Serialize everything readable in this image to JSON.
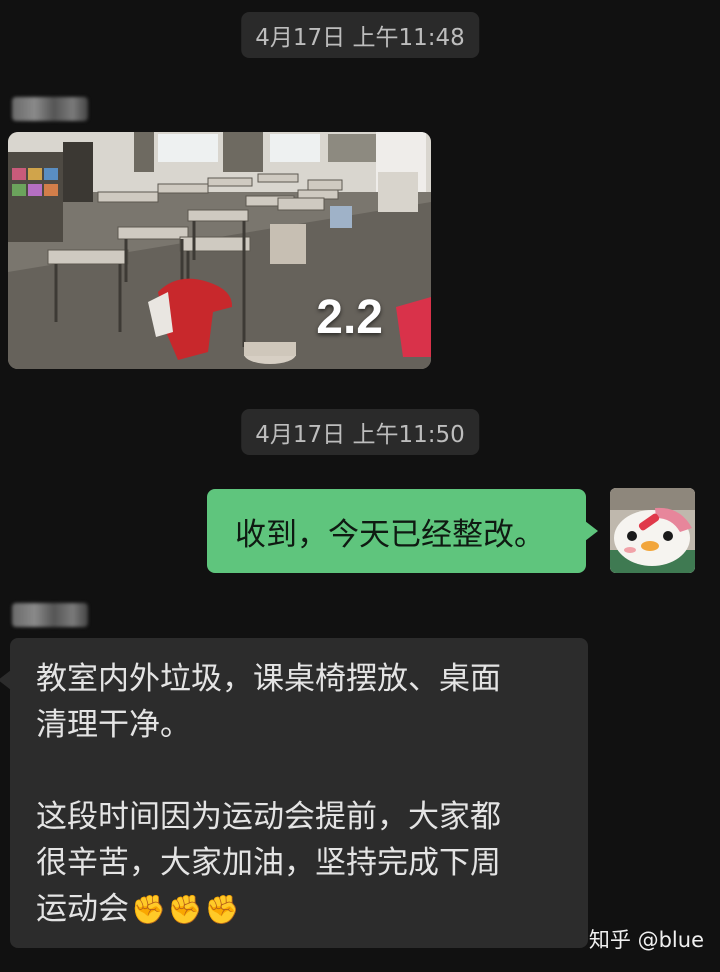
{
  "chat": {
    "timestamp_1": "4月17日 上午11:48",
    "timestamp_2": "4月17日 上午11:50",
    "sender_1_name": "",
    "sender_2_name": "",
    "image_message": {
      "overlay_text": "2.2"
    },
    "outgoing_message": {
      "text": "收到，今天已经整改。"
    },
    "incoming_message": {
      "lines": [
        "教室内外垃圾，课桌椅摆放、桌面",
        "清理干净。",
        "这段时间因为运动会提前，大家都",
        "很辛苦，大家加油，坚持完成下周",
        "运动会"
      ],
      "emojis": [
        "✊",
        "✊",
        "✊"
      ]
    }
  },
  "watermark": "知乎 @blue",
  "colors": {
    "background": "#111111",
    "outgoing_bubble": "#5fc57d",
    "incoming_bubble": "#2c2c2c",
    "timestamp_bg": "#2a2a2a"
  }
}
